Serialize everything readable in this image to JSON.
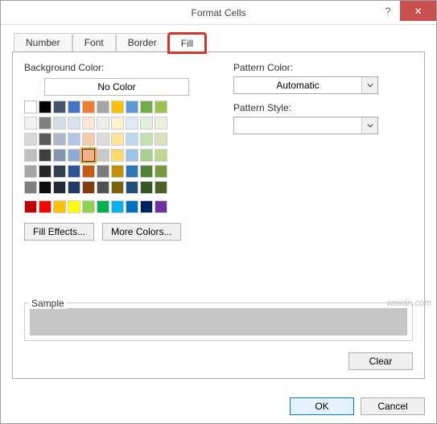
{
  "window": {
    "title": "Format Cells",
    "help_icon": "?",
    "close_icon": "✕"
  },
  "tabs": {
    "number": "Number",
    "font": "Font",
    "border": "Border",
    "fill": "Fill"
  },
  "fill": {
    "bg_label": "Background Color:",
    "no_color": "No Color",
    "theme_colors": [
      [
        "#ffffff",
        "#000000",
        "#44546a",
        "#4472c4",
        "#ed7d31",
        "#a5a5a5",
        "#ffc000",
        "#5b9bd5",
        "#70ad47",
        "#9ec24c"
      ],
      [
        "#f2f2f2",
        "#7f7f7f",
        "#d6dce4",
        "#d9e2f3",
        "#fbe5d5",
        "#ededed",
        "#fff2cc",
        "#deebf6",
        "#e2efd9",
        "#ecf2d9"
      ],
      [
        "#d8d8d8",
        "#595959",
        "#adb9ca",
        "#b4c6e7",
        "#f7caac",
        "#dbdbdb",
        "#fee599",
        "#bdd7ee",
        "#c5e0b3",
        "#d9e2b8"
      ],
      [
        "#bfbfbf",
        "#3f3f3f",
        "#8496b0",
        "#8eaadb",
        "#f4b183",
        "#c9c9c9",
        "#ffd965",
        "#9cc3e5",
        "#a8d08d",
        "#c1d78b"
      ],
      [
        "#a5a5a5",
        "#262626",
        "#323f4f",
        "#2f5496",
        "#c55a11",
        "#7b7b7b",
        "#bf9000",
        "#2e75b5",
        "#538135",
        "#7b9a3f"
      ],
      [
        "#7f7f7f",
        "#0c0c0c",
        "#222a35",
        "#1f3864",
        "#833c0b",
        "#525252",
        "#7f6000",
        "#1e4e79",
        "#375623",
        "#4e6227"
      ]
    ],
    "standard_colors": [
      "#c00000",
      "#ff0000",
      "#ffc000",
      "#ffff00",
      "#92d050",
      "#00b050",
      "#00b0f0",
      "#0070c0",
      "#002060",
      "#7030a0"
    ],
    "selected_index": [
      3,
      4
    ],
    "fill_effects": "Fill Effects...",
    "more_colors": "More Colors..."
  },
  "pattern": {
    "color_label": "Pattern Color:",
    "color_value": "Automatic",
    "style_label": "Pattern Style:",
    "style_value": ""
  },
  "sample": {
    "label": "Sample"
  },
  "buttons": {
    "clear": "Clear",
    "ok": "OK",
    "cancel": "Cancel"
  },
  "watermark": "wsxdn.com"
}
